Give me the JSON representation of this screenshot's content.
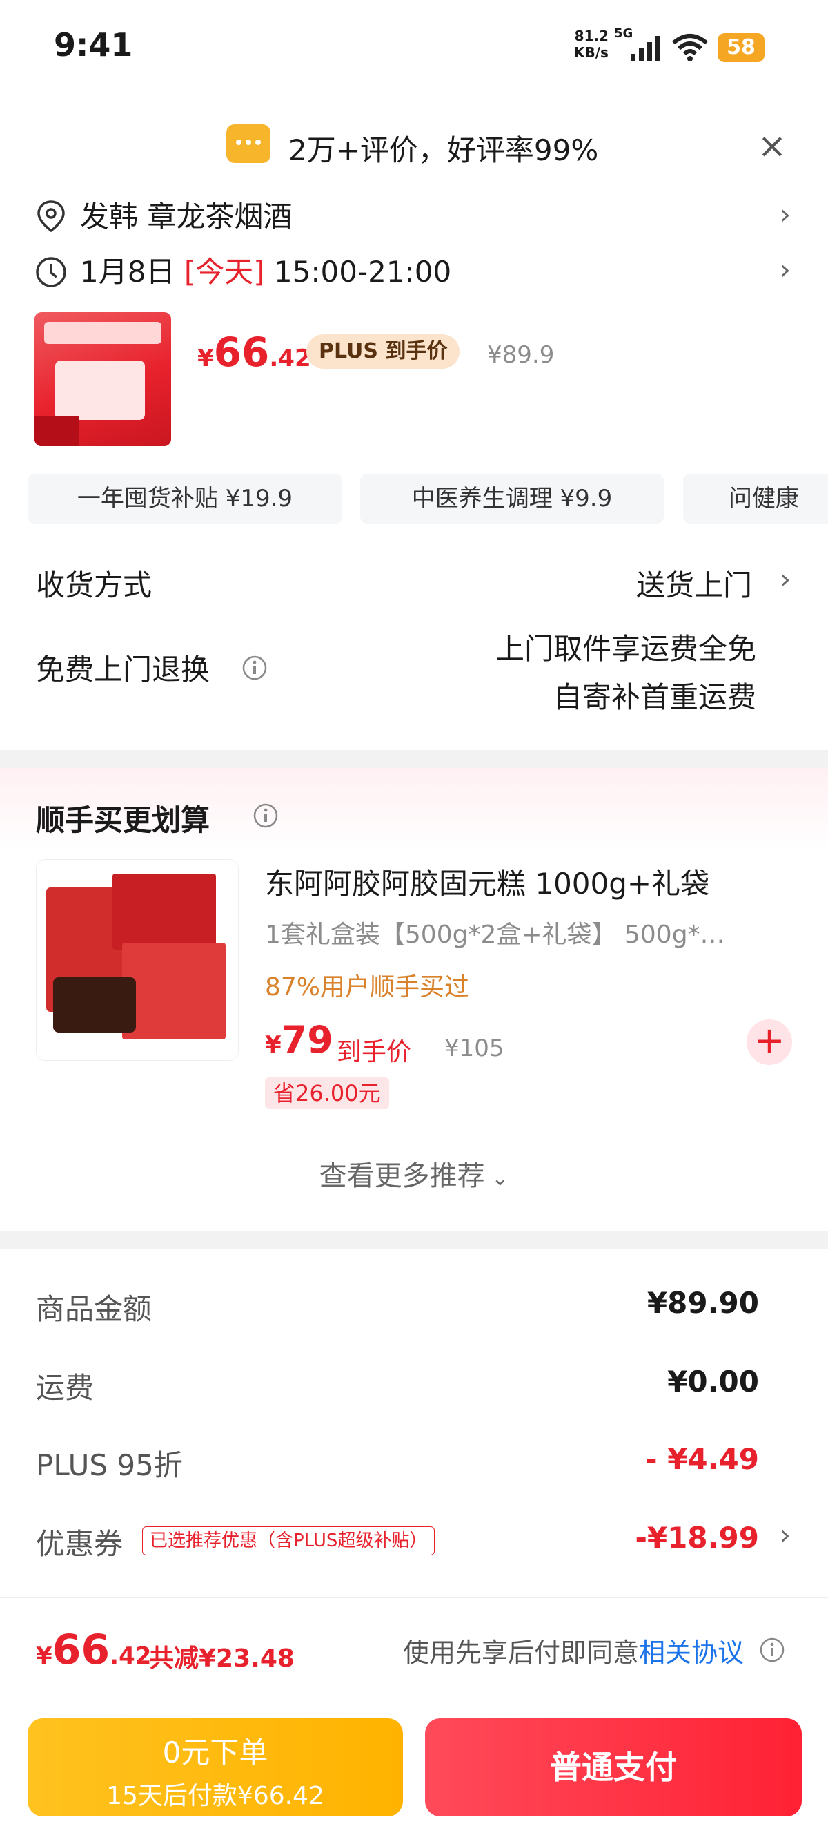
{
  "status_bar": {
    "time": "9:41",
    "net_speed": "81.2",
    "net_unit": "KB/s",
    "net_type": "5G",
    "battery": "58"
  },
  "review_banner": {
    "text": "2万+评价，好评率99%",
    "close_icon": "close-icon"
  },
  "address": {
    "text": "发韩  章龙茶烟酒"
  },
  "delivery_time": {
    "date": "1月8日",
    "tag": "[今天]",
    "window": "15:00-21:00"
  },
  "product": {
    "price_currency": "¥",
    "price_int": "66",
    "price_dec": ".42",
    "plus_badge": "PLUS 到手价",
    "original_price": "¥89.9"
  },
  "subsidy_tabs": [
    {
      "label": "一年囤货补贴  ¥19.9"
    },
    {
      "label": "中医养生调理  ¥9.9"
    },
    {
      "label": "问健康"
    }
  ],
  "shipping": {
    "label": "收货方式",
    "value": "送货上门"
  },
  "free_return": {
    "label": "免费上门退换",
    "line1": "上门取件享运费全免",
    "line2": "自寄补首重运费"
  },
  "recommend": {
    "title": "顺手买更划算",
    "item": {
      "name": "东阿阿胶阿胶固元糕 1000g+礼袋",
      "spec": "1套礼盒装【500g*2盒+礼袋】 500g*…",
      "buyers": "87%用户顺手买过",
      "price_currency": "¥",
      "price": "79",
      "price_label": "到手价",
      "original_price": "¥105",
      "save": "省26.00元"
    },
    "more": "查看更多推荐",
    "add_icon": "plus-icon"
  },
  "summary": {
    "goods_label": "商品金额",
    "goods_value": "¥89.90",
    "freight_label": "运费",
    "freight_value": "¥0.00",
    "plus_label": "PLUS 95折",
    "plus_value": "- ¥4.49",
    "coupon_label": "优惠券",
    "coupon_tag": "已选推荐优惠（含PLUS超级补贴）",
    "coupon_value": "-¥18.99"
  },
  "footer": {
    "total_currency": "¥",
    "total_int": "66",
    "total_dec": ".42",
    "reduced": "共减¥23.48",
    "agreement_text": "使用先享后付即同意",
    "agreement_link": "相关协议"
  },
  "buttons": {
    "paylater_title": "0元下单",
    "paylater_sub": "15天后付款¥66.42",
    "pay": "普通支付"
  },
  "colors": {
    "accent_red": "#e8222d",
    "pay_yellow": "#ffb300",
    "pay_red": "#ff2134",
    "buyers_orange": "#d9822b",
    "link_blue": "#1a73e8"
  }
}
